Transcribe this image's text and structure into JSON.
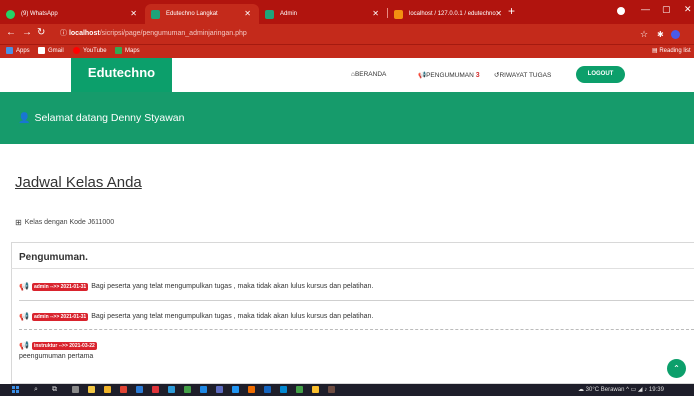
{
  "browser": {
    "tabs": [
      {
        "label": "(9) WhatsApp",
        "color": "#25d366"
      },
      {
        "label": "Edutechno Langkat",
        "color": "#1fa37a"
      },
      {
        "label": "Admin",
        "color": "#1fa37a"
      },
      {
        "label": "localhost / 127.0.0.1 / edutechno",
        "color": "#f29111"
      }
    ],
    "url_host": "localhost",
    "url_path": "/sicripsi/page/pengumuman_adminjaringan.php",
    "bookmarks": [
      {
        "label": "Apps",
        "color": "#4a90e2"
      },
      {
        "label": "Gmail",
        "color": "#ffffff"
      },
      {
        "label": "YouTube",
        "color": "#ff0000"
      },
      {
        "label": "Maps",
        "color": "#34a853"
      }
    ],
    "reading_list": "Reading list"
  },
  "site": {
    "brand": "Edutechno",
    "menu": {
      "beranda": "BERANDA",
      "pengumuman": "PENGUMUMAN",
      "pengumuman_count": "3",
      "riwayat": "RIWAYAT TUGAS",
      "logout": "LOGOUT"
    },
    "welcome": "Selamat datang Denny Styawan",
    "schedule_title": "Jadwal Kelas Anda",
    "class_code_text": "Kelas dengan Kode J611000"
  },
  "announcements": {
    "title": "Pengumuman.",
    "items": [
      {
        "tag": "admin -->> 2021-01-31",
        "text": "Bagi peserta yang telat mengumpulkan tugas , maka tidak akan lulus kursus dan pelatihan."
      },
      {
        "tag": "admin -->> 2021-01-31",
        "text": "Bagi peserta yang telat mengumpulkan tugas , maka tidak akan lulus kursus dan pelatihan."
      },
      {
        "tag": "instruktur -->> 2021-03-22",
        "text": "peengumuman pertama"
      }
    ]
  },
  "taskbar": {
    "weather": "30°C Berawan",
    "time": "19:39"
  },
  "colors": {
    "chrome_red": "#c42a1b",
    "brand_green": "#0c9f6b",
    "tag_red": "#d9232d"
  }
}
